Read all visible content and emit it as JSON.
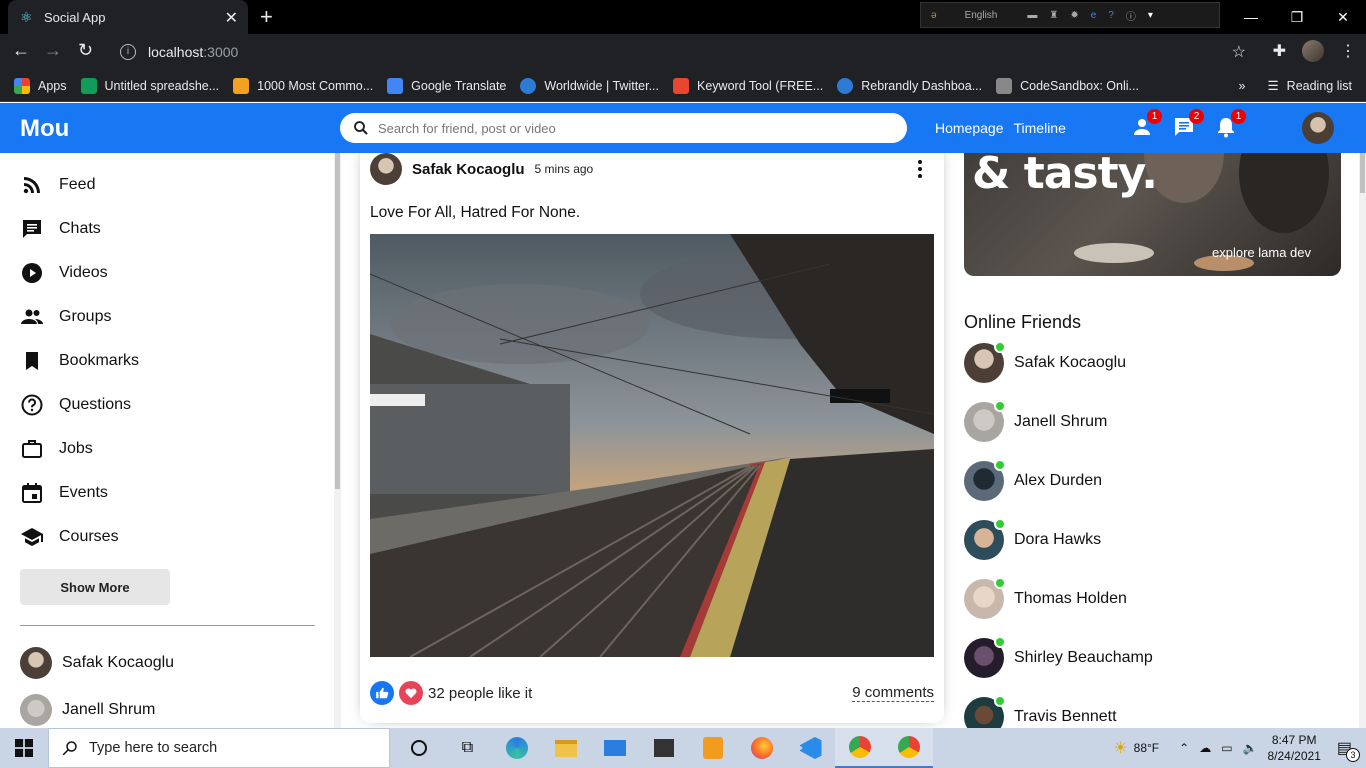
{
  "browser": {
    "tab_title": "Social App",
    "url_host": "localhost",
    "url_port": ":3000",
    "ext_language": "English",
    "bookmarks": [
      {
        "label": "Apps",
        "color": "#e94235"
      },
      {
        "label": "Untitled spreadshe...",
        "color": "#0f9d58"
      },
      {
        "label": "1000 Most Commo...",
        "color": "#f4a020"
      },
      {
        "label": "Google Translate",
        "color": "#4285f4"
      },
      {
        "label": "Worldwide | Twitter...",
        "color": "#2d7bd4"
      },
      {
        "label": "Keyword Tool (FREE...",
        "color": "#e8462e"
      },
      {
        "label": "Rebrandly Dashboa...",
        "color": "#2d7bd4"
      },
      {
        "label": "CodeSandbox: Onli...",
        "color": "#888888"
      }
    ],
    "overflow": "»",
    "reading_list": "Reading list"
  },
  "topbar": {
    "logo": "Mou",
    "search_placeholder": "Search for friend, post or video",
    "links": [
      "Homepage",
      "Timeline"
    ],
    "badges": {
      "friends": "1",
      "chat": "2",
      "notifications": "1"
    },
    "brand_color": "#1877f2"
  },
  "sidebar": {
    "items": [
      {
        "label": "Feed",
        "icon": "rss-feed-icon"
      },
      {
        "label": "Chats",
        "icon": "chat-icon"
      },
      {
        "label": "Videos",
        "icon": "play-circle-icon"
      },
      {
        "label": "Groups",
        "icon": "group-icon"
      },
      {
        "label": "Bookmarks",
        "icon": "bookmark-icon"
      },
      {
        "label": "Questions",
        "icon": "help-outline-icon"
      },
      {
        "label": "Jobs",
        "icon": "work-outline-icon"
      },
      {
        "label": "Events",
        "icon": "event-icon"
      },
      {
        "label": "Courses",
        "icon": "school-icon"
      }
    ],
    "show_more": "Show More",
    "friends": [
      "Safak Kocaoglu",
      "Janell Shrum"
    ]
  },
  "post": {
    "username": "Safak Kocaoglu",
    "date": "5 mins ago",
    "text": "Love For All, Hatred For None.",
    "likes": "32 people like it",
    "comments": "9 comments"
  },
  "rightbar": {
    "ad_title": "& tasty.",
    "ad_sub": "explore lama dev",
    "online_title": "Online Friends",
    "friends": [
      "Safak Kocaoglu",
      "Janell Shrum",
      "Alex Durden",
      "Dora Hawks",
      "Thomas Holden",
      "Shirley Beauchamp",
      "Travis Bennett"
    ]
  },
  "taskbar": {
    "search_placeholder": "Type here to search",
    "temperature": "88°F",
    "time": "8:47 PM",
    "date": "8/24/2021",
    "notifications": "3"
  }
}
